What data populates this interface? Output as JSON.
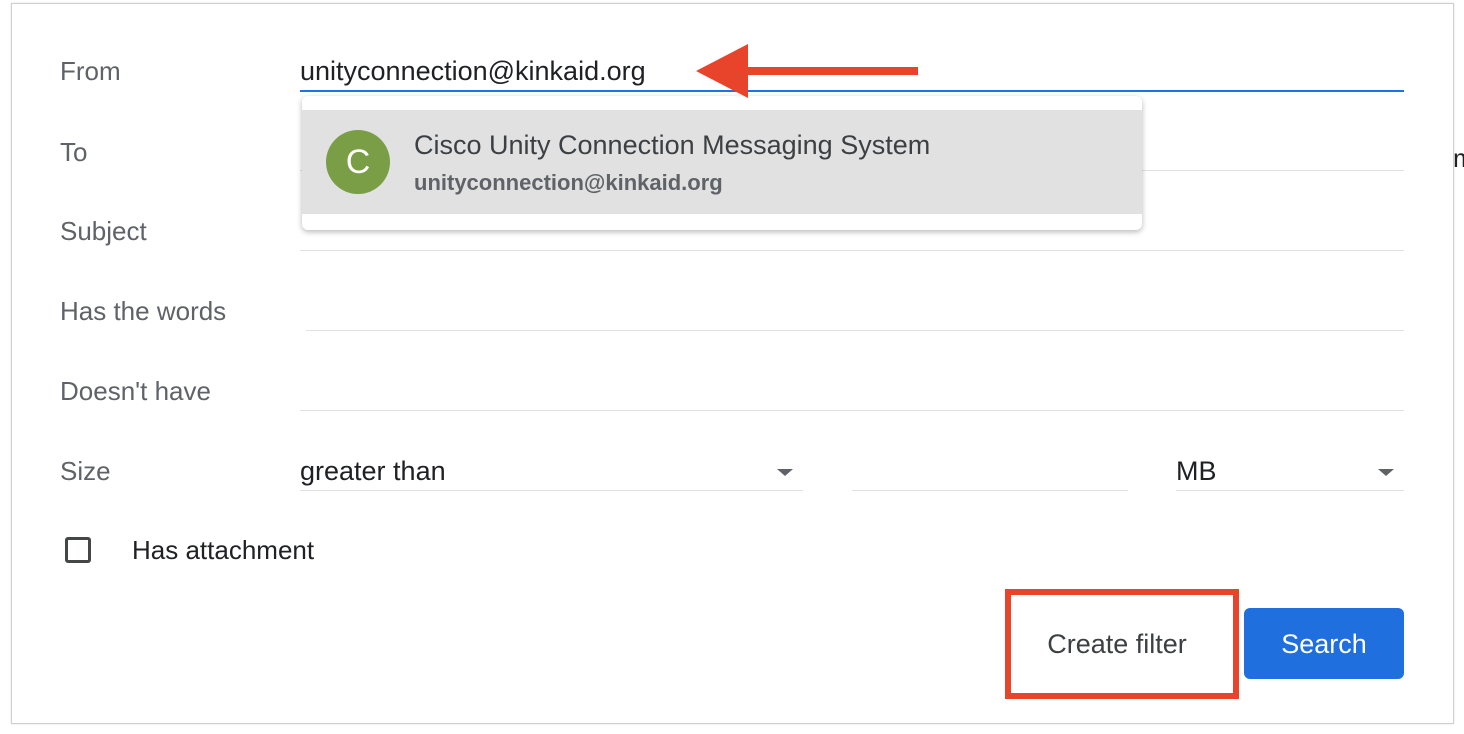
{
  "form": {
    "from_label": "From",
    "from_value": "unityconnection@kinkaid.org",
    "to_label": "To",
    "to_clip_text": "m",
    "subject_label": "Subject",
    "has_words_label": "Has the words",
    "doesnt_have_label": "Doesn't have",
    "size_label": "Size",
    "size_operator": "greater than",
    "size_unit": "MB",
    "has_attachment_label": "Has attachment"
  },
  "suggestion": {
    "avatar_letter": "C",
    "name": "Cisco Unity Connection Messaging System",
    "email": "unityconnection@kinkaid.org"
  },
  "buttons": {
    "create_filter": "Create filter",
    "search": "Search"
  },
  "colors": {
    "annotation_red": "#e8432b",
    "search_blue": "#1f6fde",
    "avatar_green": "#7a9e45",
    "focus_blue": "#1a73e8"
  }
}
